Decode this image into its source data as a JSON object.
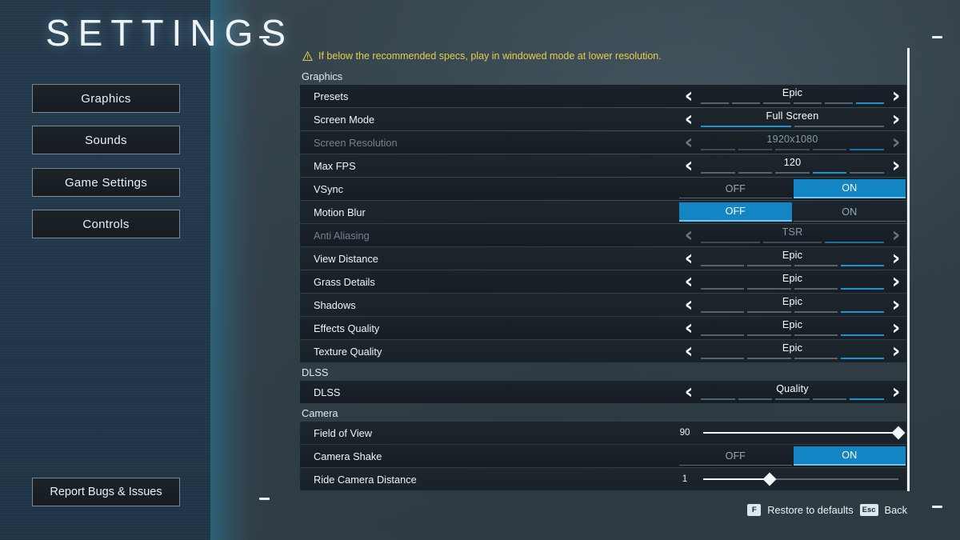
{
  "title": "SETTINGS",
  "sidebar": {
    "items": [
      {
        "label": "Graphics"
      },
      {
        "label": "Sounds"
      },
      {
        "label": "Game Settings"
      },
      {
        "label": "Controls"
      }
    ],
    "report_button": "Report Bugs & Issues"
  },
  "warning": {
    "icon": "warning-icon",
    "text": "If below the recommended specs, play in windowed mode at lower resolution.",
    "color": "#e2cf52"
  },
  "colors": {
    "accent": "#1f93d0",
    "toggle_active": "#1384c4",
    "panel": "#1a222a",
    "left_panel": "#22384b"
  },
  "footer": {
    "hints": [
      {
        "key": "F",
        "label": "Restore to defaults"
      },
      {
        "key": "Esc",
        "label": "Back"
      }
    ]
  },
  "groups": [
    {
      "name": "Graphics",
      "rows": [
        {
          "label": "Presets",
          "type": "stepper",
          "value": "Epic",
          "segments": 6,
          "active": 6,
          "disabled": false
        },
        {
          "label": "Screen Mode",
          "type": "stepper",
          "value": "Full Screen",
          "segments": 2,
          "active": 1,
          "disabled": false
        },
        {
          "label": "Screen Resolution",
          "type": "stepper",
          "value": "1920x1080",
          "segments": 5,
          "active": 5,
          "disabled": true
        },
        {
          "label": "Max FPS",
          "type": "stepper",
          "value": "120",
          "segments": 5,
          "active": 4,
          "disabled": false
        },
        {
          "label": "VSync",
          "type": "toggle",
          "value": "ON",
          "off_label": "OFF",
          "on_label": "ON",
          "disabled": false
        },
        {
          "label": "Motion Blur",
          "type": "toggle",
          "value": "OFF",
          "off_label": "OFF",
          "on_label": "ON",
          "disabled": false
        },
        {
          "label": "Anti Aliasing",
          "type": "stepper",
          "value": "TSR",
          "segments": 3,
          "active": 3,
          "disabled": true
        },
        {
          "label": "View Distance",
          "type": "stepper",
          "value": "Epic",
          "segments": 4,
          "active": 4,
          "disabled": false
        },
        {
          "label": "Grass Details",
          "type": "stepper",
          "value": "Epic",
          "segments": 4,
          "active": 4,
          "disabled": false
        },
        {
          "label": "Shadows",
          "type": "stepper",
          "value": "Epic",
          "segments": 4,
          "active": 4,
          "disabled": false
        },
        {
          "label": "Effects Quality",
          "type": "stepper",
          "value": "Epic",
          "segments": 4,
          "active": 4,
          "disabled": false
        },
        {
          "label": "Texture Quality",
          "type": "stepper",
          "value": "Epic",
          "segments": 4,
          "active": 4,
          "disabled": false
        }
      ]
    },
    {
      "name": "DLSS",
      "rows": [
        {
          "label": "DLSS",
          "type": "stepper",
          "value": "Quality",
          "segments": 5,
          "active": 5,
          "disabled": false
        }
      ]
    },
    {
      "name": "Camera",
      "rows": [
        {
          "label": "Field of View",
          "type": "slider",
          "value": "90",
          "percent": 100,
          "disabled": false
        },
        {
          "label": "Camera Shake",
          "type": "toggle",
          "value": "ON",
          "off_label": "OFF",
          "on_label": "ON",
          "disabled": false
        },
        {
          "label": "Ride Camera Distance",
          "type": "slider",
          "value": "1",
          "percent": 34,
          "disabled": false
        }
      ]
    }
  ]
}
